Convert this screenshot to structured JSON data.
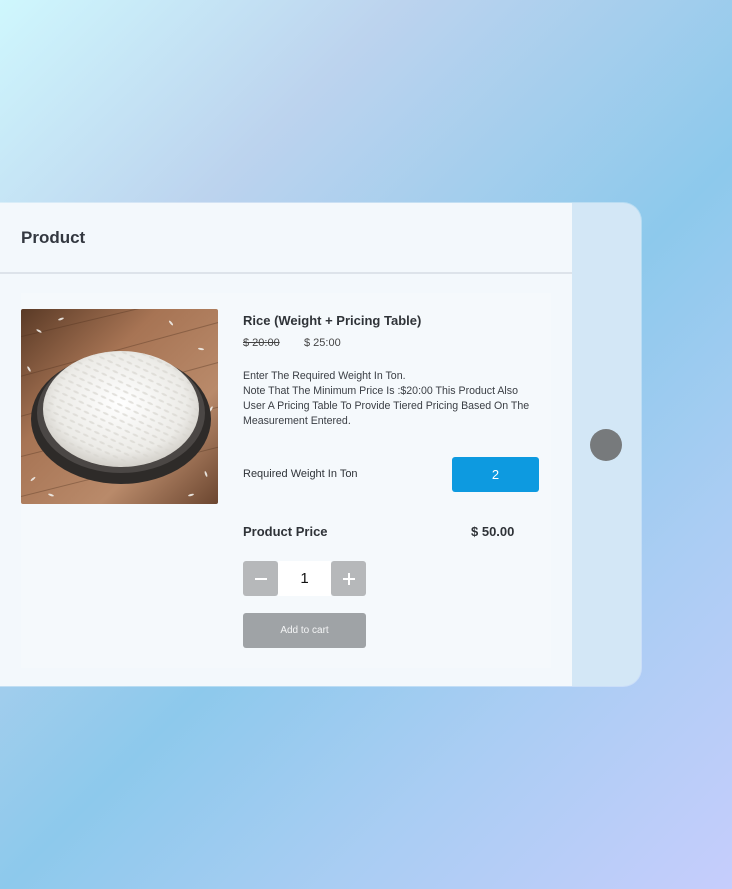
{
  "page": {
    "title": "Product"
  },
  "product": {
    "name": "Rice (Weight + Pricing Table)",
    "original_price": "$ 20:00",
    "sale_price": "$ 25:00",
    "description_lines": [
      "Enter The Required Weight In Ton.",
      "Note That The Minimum Price Is :$20:00 This Product Also",
      "User A Pricing Table To Provide Tiered Pricing Based On The",
      "Measurement Entered."
    ],
    "image_icon": "rice-bowl-photo"
  },
  "weight": {
    "label": "Required Weight In Ton",
    "value": "2"
  },
  "pricing": {
    "label": "Product Price",
    "value": "$ 50.00"
  },
  "quantity": {
    "value": "1",
    "minus_icon": "minus-icon",
    "plus_icon": "plus-icon"
  },
  "cart": {
    "button_label": "Add to cart"
  },
  "colors": {
    "accent": "#0d9ae0",
    "button_gray": "#9fa3a6",
    "stepper_gray": "#b6b8ba",
    "home_button": "#777a7c"
  }
}
